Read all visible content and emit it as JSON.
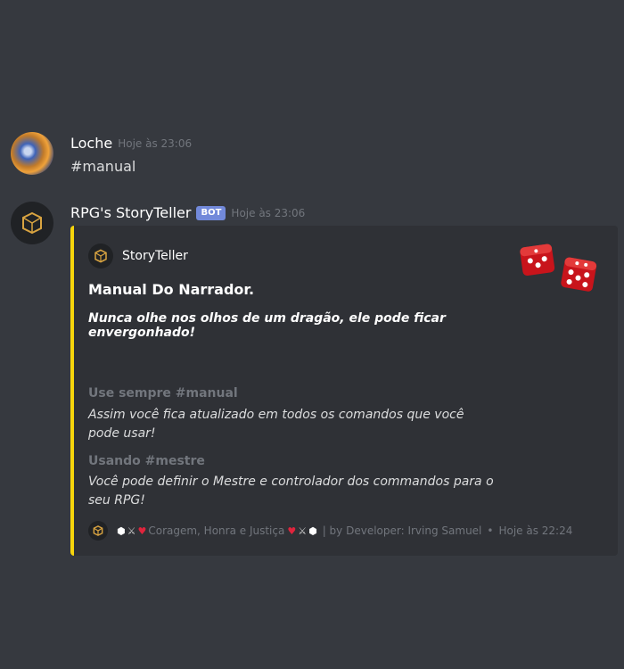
{
  "messages": [
    {
      "author": "Loche",
      "timestamp": "Hoje às 23:06",
      "content": "#manual"
    },
    {
      "author": "RPG's StoryTeller",
      "badge": "BOT",
      "timestamp": "Hoje às 23:06",
      "embed": {
        "accent_color": "#f7d50c",
        "author_name": "StoryTeller",
        "title": "Manual Do Narrador.",
        "description": "Nunca olhe nos olhos de um dragão, ele pode ficar envergonhado!",
        "fields": [
          {
            "name": "Use sempre #manual",
            "value": "Assim você fica atualizado em todos os comandos que você pode usar!"
          },
          {
            "name": "Usando #mestre",
            "value": "Você pode definir o Mestre e controlador dos commandos para o seu RPG!"
          }
        ],
        "footer": {
          "text": "Coragem, Honra e Justiça",
          "by_text": "| by Developer: Irving Samuel",
          "separator": "•",
          "timestamp": "Hoje às 22:24"
        }
      }
    }
  ],
  "icons": {
    "user_avatar": "avatar-icon",
    "bot_avatar": "dice-logo-icon",
    "thumbnail": "red-dice-icon"
  }
}
